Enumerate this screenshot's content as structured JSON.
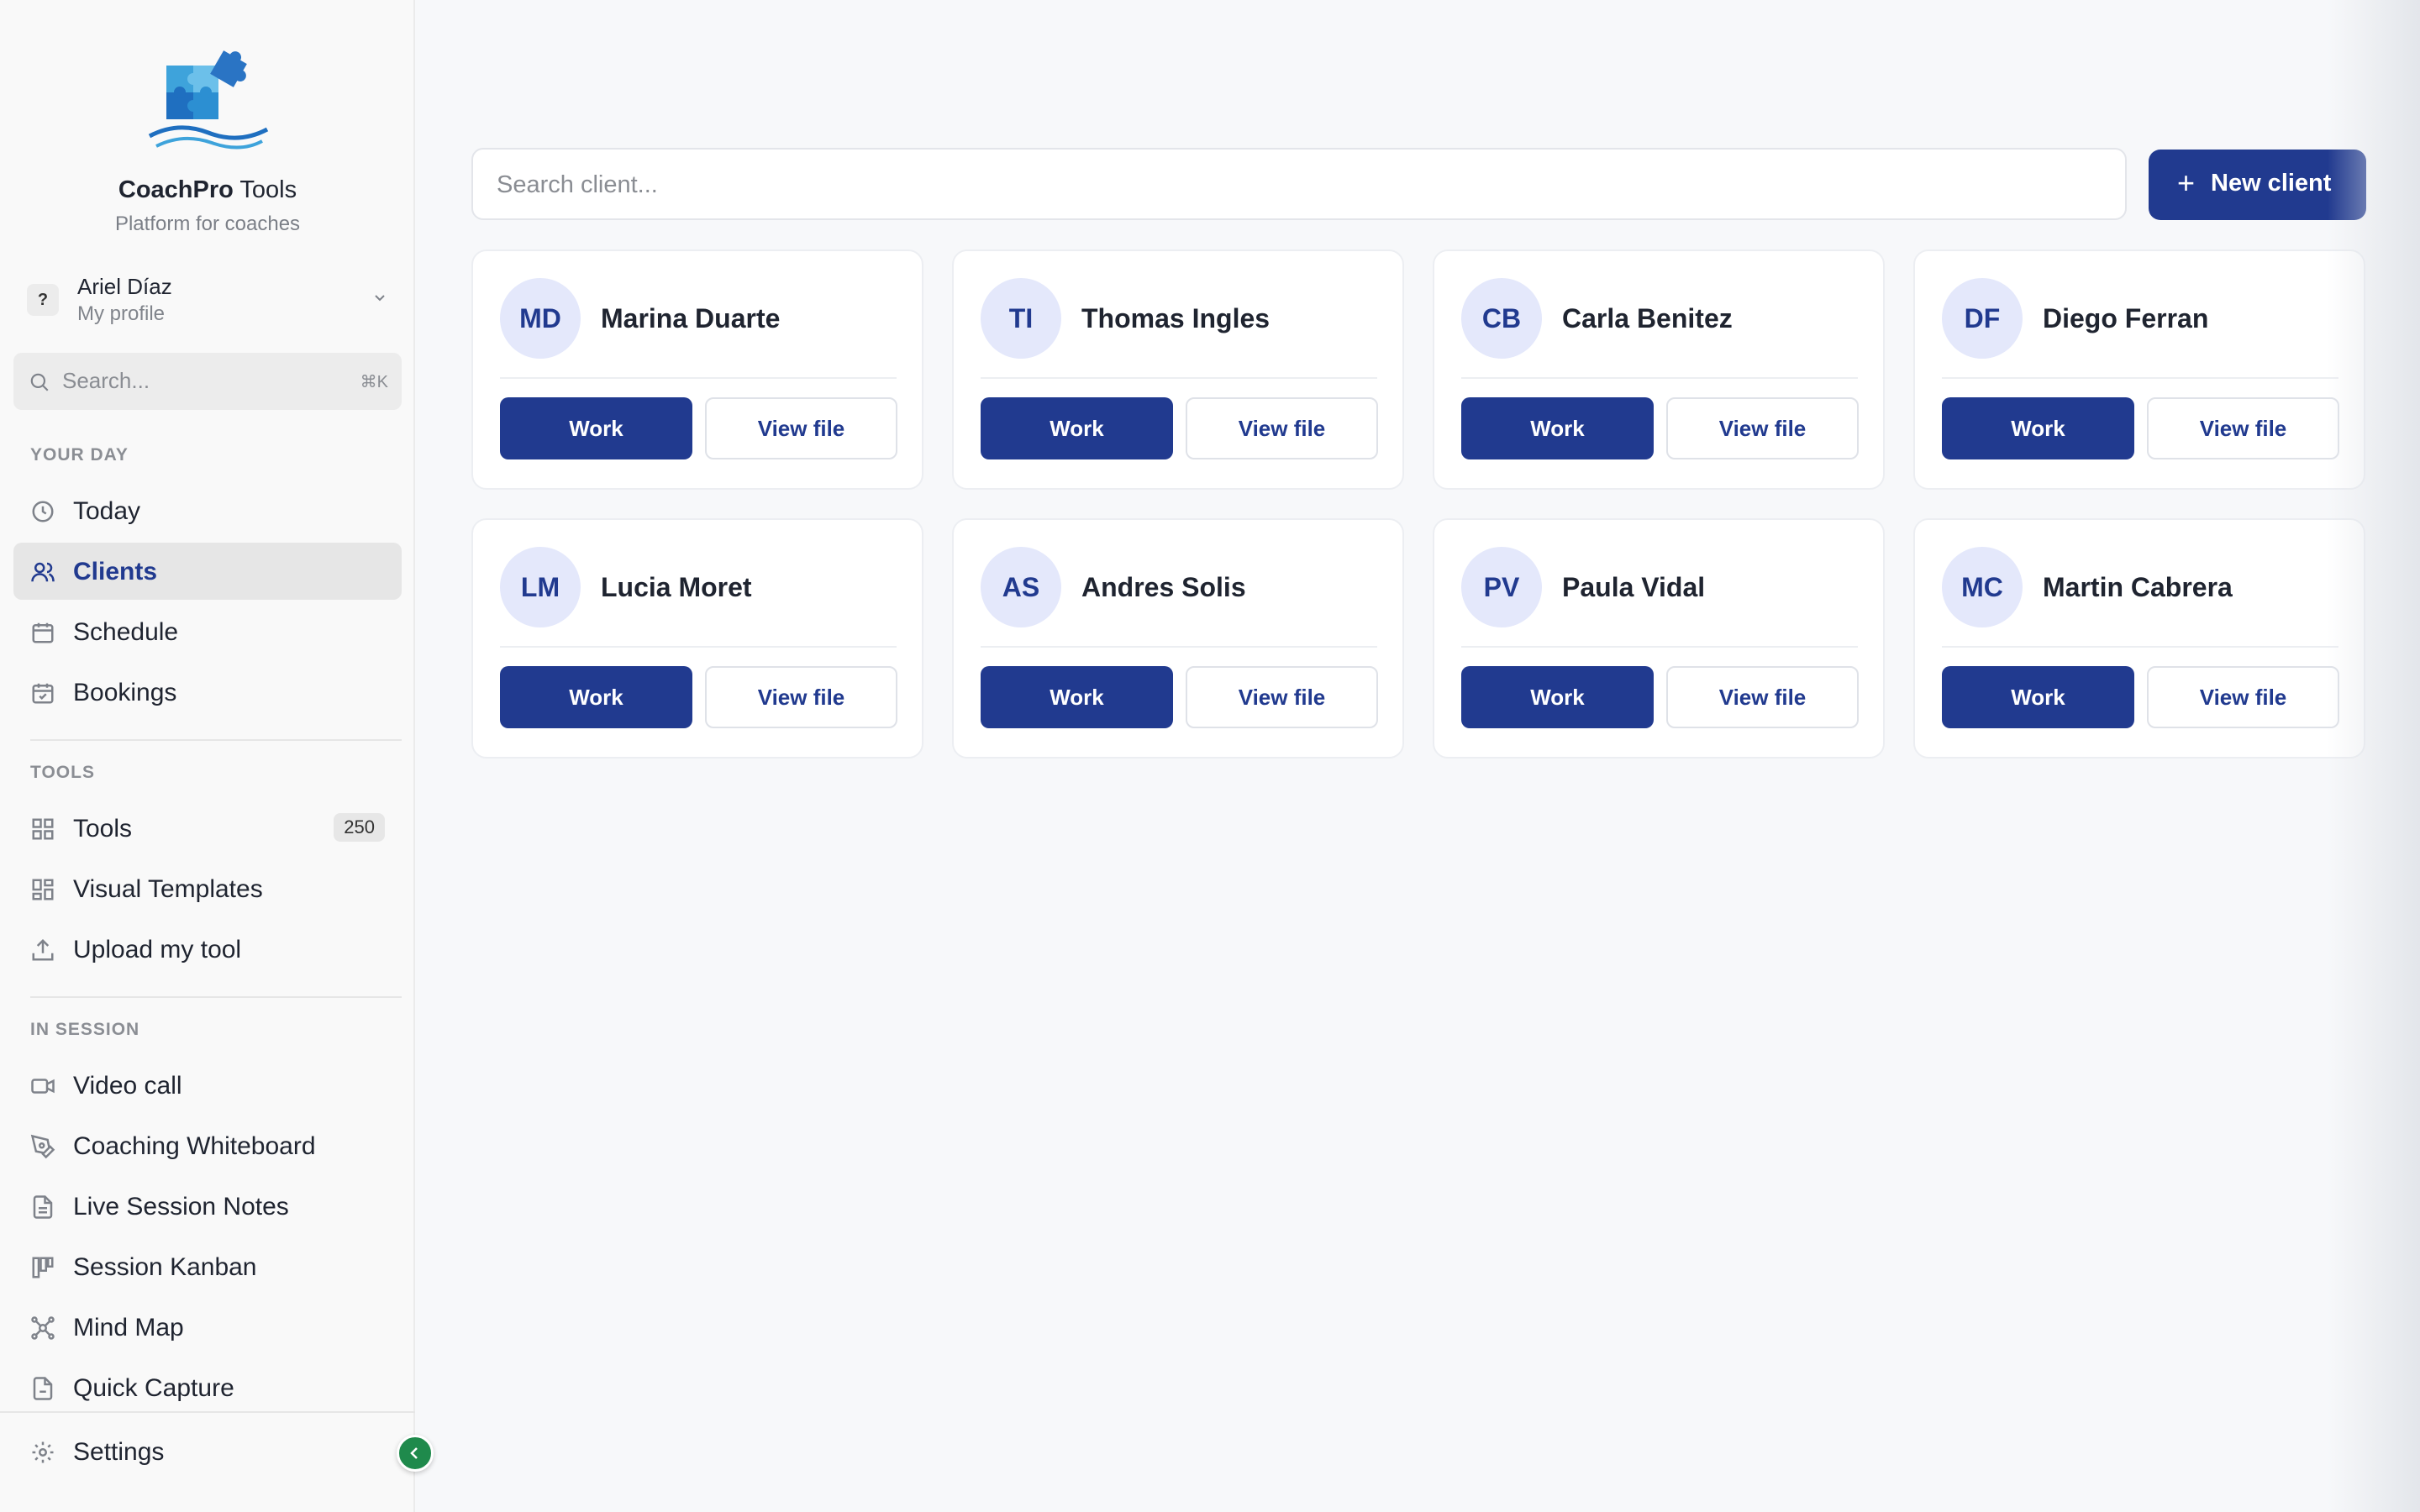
{
  "brand": {
    "name_bold": "CoachPro",
    "name_rest": " Tools",
    "subtitle": "Platform for coaches"
  },
  "profile": {
    "badge": "?",
    "name": "Ariel Díaz",
    "sub": "My profile"
  },
  "sidebar_search": {
    "placeholder": "Search...",
    "shortcut": "⌘K"
  },
  "sections": {
    "your_day": "YOUR DAY",
    "tools": "TOOLS",
    "in_session": "IN SESSION"
  },
  "nav": {
    "today": "Today",
    "clients": "Clients",
    "schedule": "Schedule",
    "bookings": "Bookings",
    "tools": "Tools",
    "tools_count": "250",
    "visual_templates": "Visual Templates",
    "upload_tool": "Upload my tool",
    "video_call": "Video call",
    "coaching_whiteboard": "Coaching Whiteboard",
    "live_session_notes": "Live Session Notes",
    "session_kanban": "Session Kanban",
    "mind_map": "Mind Map",
    "quick_capture": "Quick Capture",
    "settings": "Settings"
  },
  "main": {
    "search_placeholder": "Search client...",
    "new_client_label": "New client",
    "new_client_plus": "+",
    "work_label": "Work",
    "view_label": "View file"
  },
  "clients": [
    {
      "initials": "MD",
      "name": "Marina Duarte"
    },
    {
      "initials": "TI",
      "name": "Thomas Ingles"
    },
    {
      "initials": "CB",
      "name": "Carla Benitez"
    },
    {
      "initials": "DF",
      "name": "Diego Ferran"
    },
    {
      "initials": "LM",
      "name": "Lucia Moret"
    },
    {
      "initials": "AS",
      "name": "Andres Solis"
    },
    {
      "initials": "PV",
      "name": "Paula Vidal"
    },
    {
      "initials": "MC",
      "name": "Martin Cabrera"
    }
  ],
  "colors": {
    "primary": "#213a8f",
    "avatar_bg": "#e4e8fb",
    "collapse": "#1f8a4c"
  }
}
